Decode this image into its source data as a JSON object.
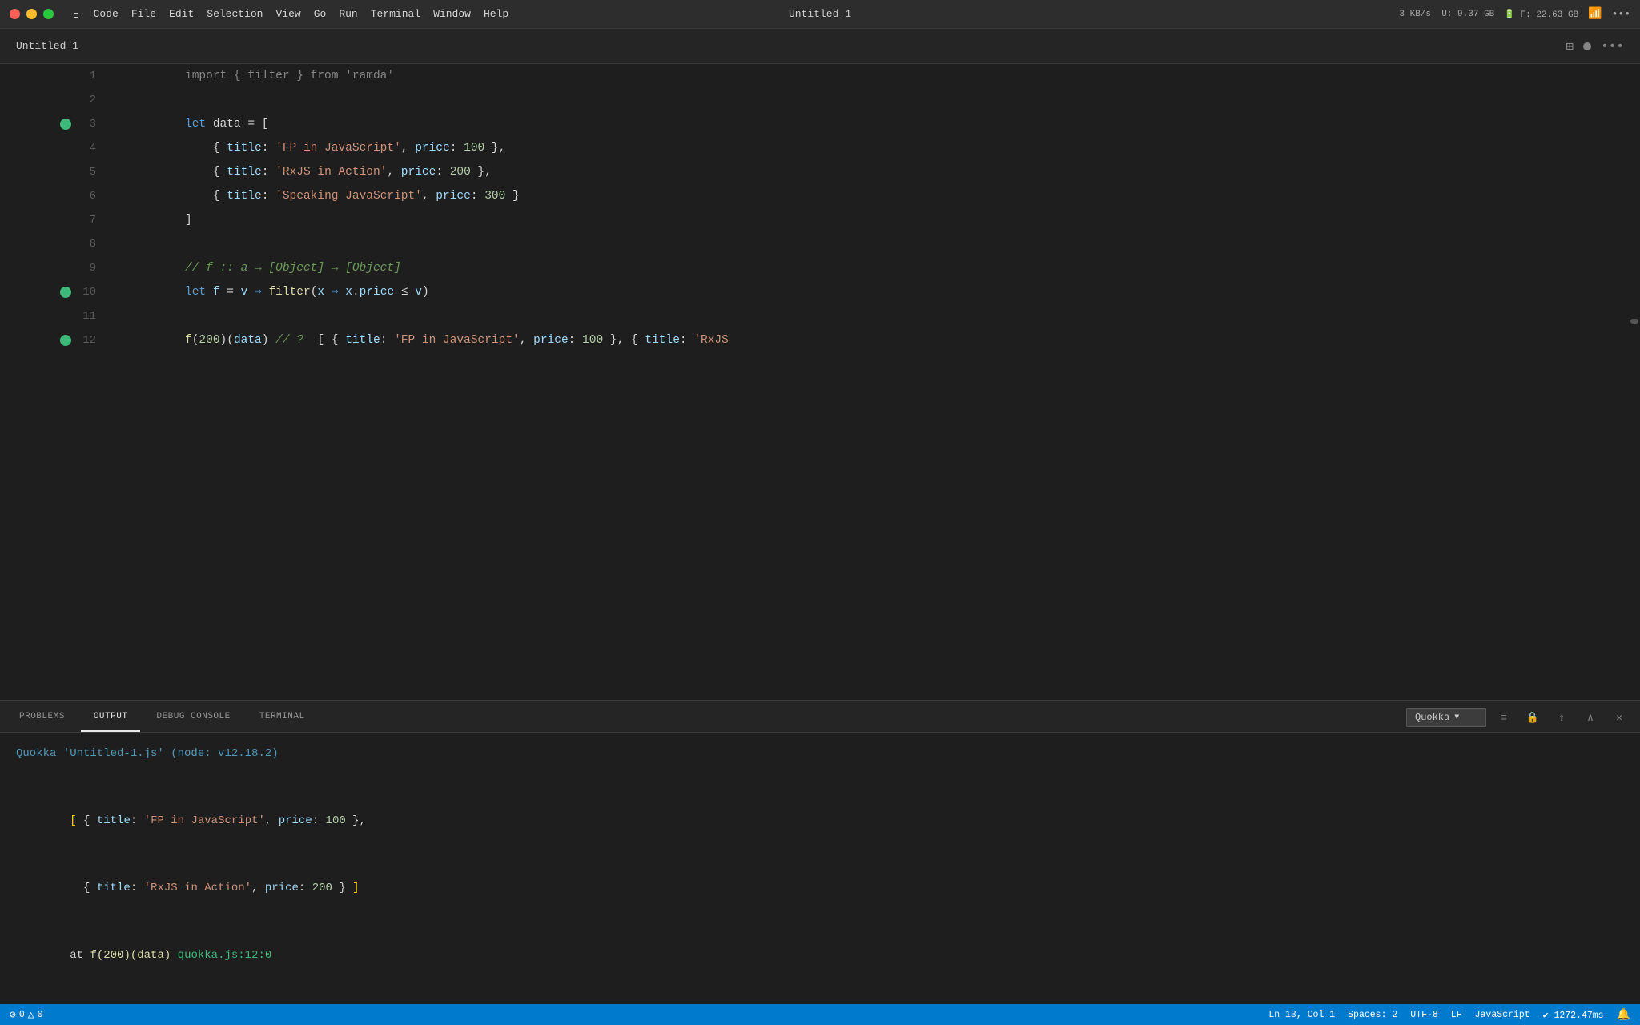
{
  "window": {
    "title": "Untitled-1",
    "tab_title": "Untitled-1"
  },
  "menubar": {
    "apple": "🍎",
    "items": [
      "Code",
      "File",
      "Edit",
      "Selection",
      "View",
      "Go",
      "Run",
      "Terminal",
      "Window",
      "Help"
    ],
    "right": {
      "network": "3 KB/s\n3 KB/s",
      "battery": "U: 9.37 GB\nF: 22.63 GB"
    }
  },
  "titlebar": {
    "title": "Untitled-1"
  },
  "code": {
    "lines": [
      {
        "num": "1",
        "has_breakpoint": false,
        "content": "import_faded"
      },
      {
        "num": "2",
        "has_breakpoint": false,
        "content": "empty"
      },
      {
        "num": "3",
        "has_breakpoint": true,
        "content": "let_data"
      },
      {
        "num": "4",
        "has_breakpoint": false,
        "content": "item1"
      },
      {
        "num": "5",
        "has_breakpoint": false,
        "content": "item2"
      },
      {
        "num": "6",
        "has_breakpoint": false,
        "content": "item3"
      },
      {
        "num": "7",
        "has_breakpoint": false,
        "content": "close_bracket"
      },
      {
        "num": "8",
        "has_breakpoint": false,
        "content": "empty"
      },
      {
        "num": "9",
        "has_breakpoint": false,
        "content": "comment"
      },
      {
        "num": "10",
        "has_breakpoint": true,
        "content": "let_f"
      },
      {
        "num": "11",
        "has_breakpoint": false,
        "content": "empty"
      },
      {
        "num": "12",
        "has_breakpoint": true,
        "content": "f_call"
      }
    ]
  },
  "panel": {
    "tabs": [
      "PROBLEMS",
      "OUTPUT",
      "DEBUG CONSOLE",
      "TERMINAL"
    ],
    "active_tab": "OUTPUT",
    "dropdown_label": "Quokka",
    "output_header": "Quokka 'Untitled-1.js' (node: v12.18.2)",
    "output_lines": [
      "[ { title: 'FP in JavaScript', price: 100 },",
      "  { title: 'RxJS in Action', price: 200 } ]",
      "at f(200)(data) quokka.js:12:0"
    ]
  },
  "statusbar": {
    "errors": "0",
    "warnings": "0",
    "ln": "Ln 13, Col 1",
    "spaces": "Spaces: 2",
    "encoding": "UTF-8",
    "eol": "LF",
    "language": "JavaScript",
    "timing": "✔ 1272.47ms"
  }
}
